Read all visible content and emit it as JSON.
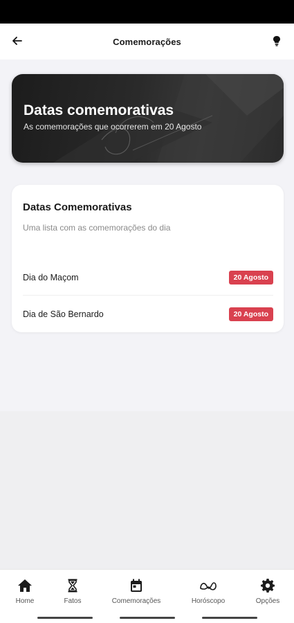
{
  "app_bar": {
    "title": "Comemorações",
    "back_icon": "arrow-left-icon",
    "action_icon": "lightbulb-icon"
  },
  "hero": {
    "title": "Datas comemorativas",
    "subtitle": "As comemorações que ocorrerem em 20 Agosto"
  },
  "card": {
    "title": "Datas Comemorativas",
    "subtitle": "Uma lista com as comemorações do dia",
    "items": [
      {
        "name": "Dia do Maçom",
        "date": "20 Agosto"
      },
      {
        "name": "Dia de São Bernardo",
        "date": "20 Agosto"
      }
    ]
  },
  "bottom_nav": {
    "items": [
      {
        "label": "Home",
        "icon": "home-icon"
      },
      {
        "label": "Fatos",
        "icon": "hourglass-icon"
      },
      {
        "label": "Comemorações",
        "icon": "calendar-icon"
      },
      {
        "label": "Horóscopo",
        "icon": "zodiac-icon"
      },
      {
        "label": "Opções",
        "icon": "gear-icon"
      }
    ]
  },
  "colors": {
    "badge": "#d9414f",
    "background": "#f3f3f7",
    "hero_dark": "#1c1c1c"
  }
}
